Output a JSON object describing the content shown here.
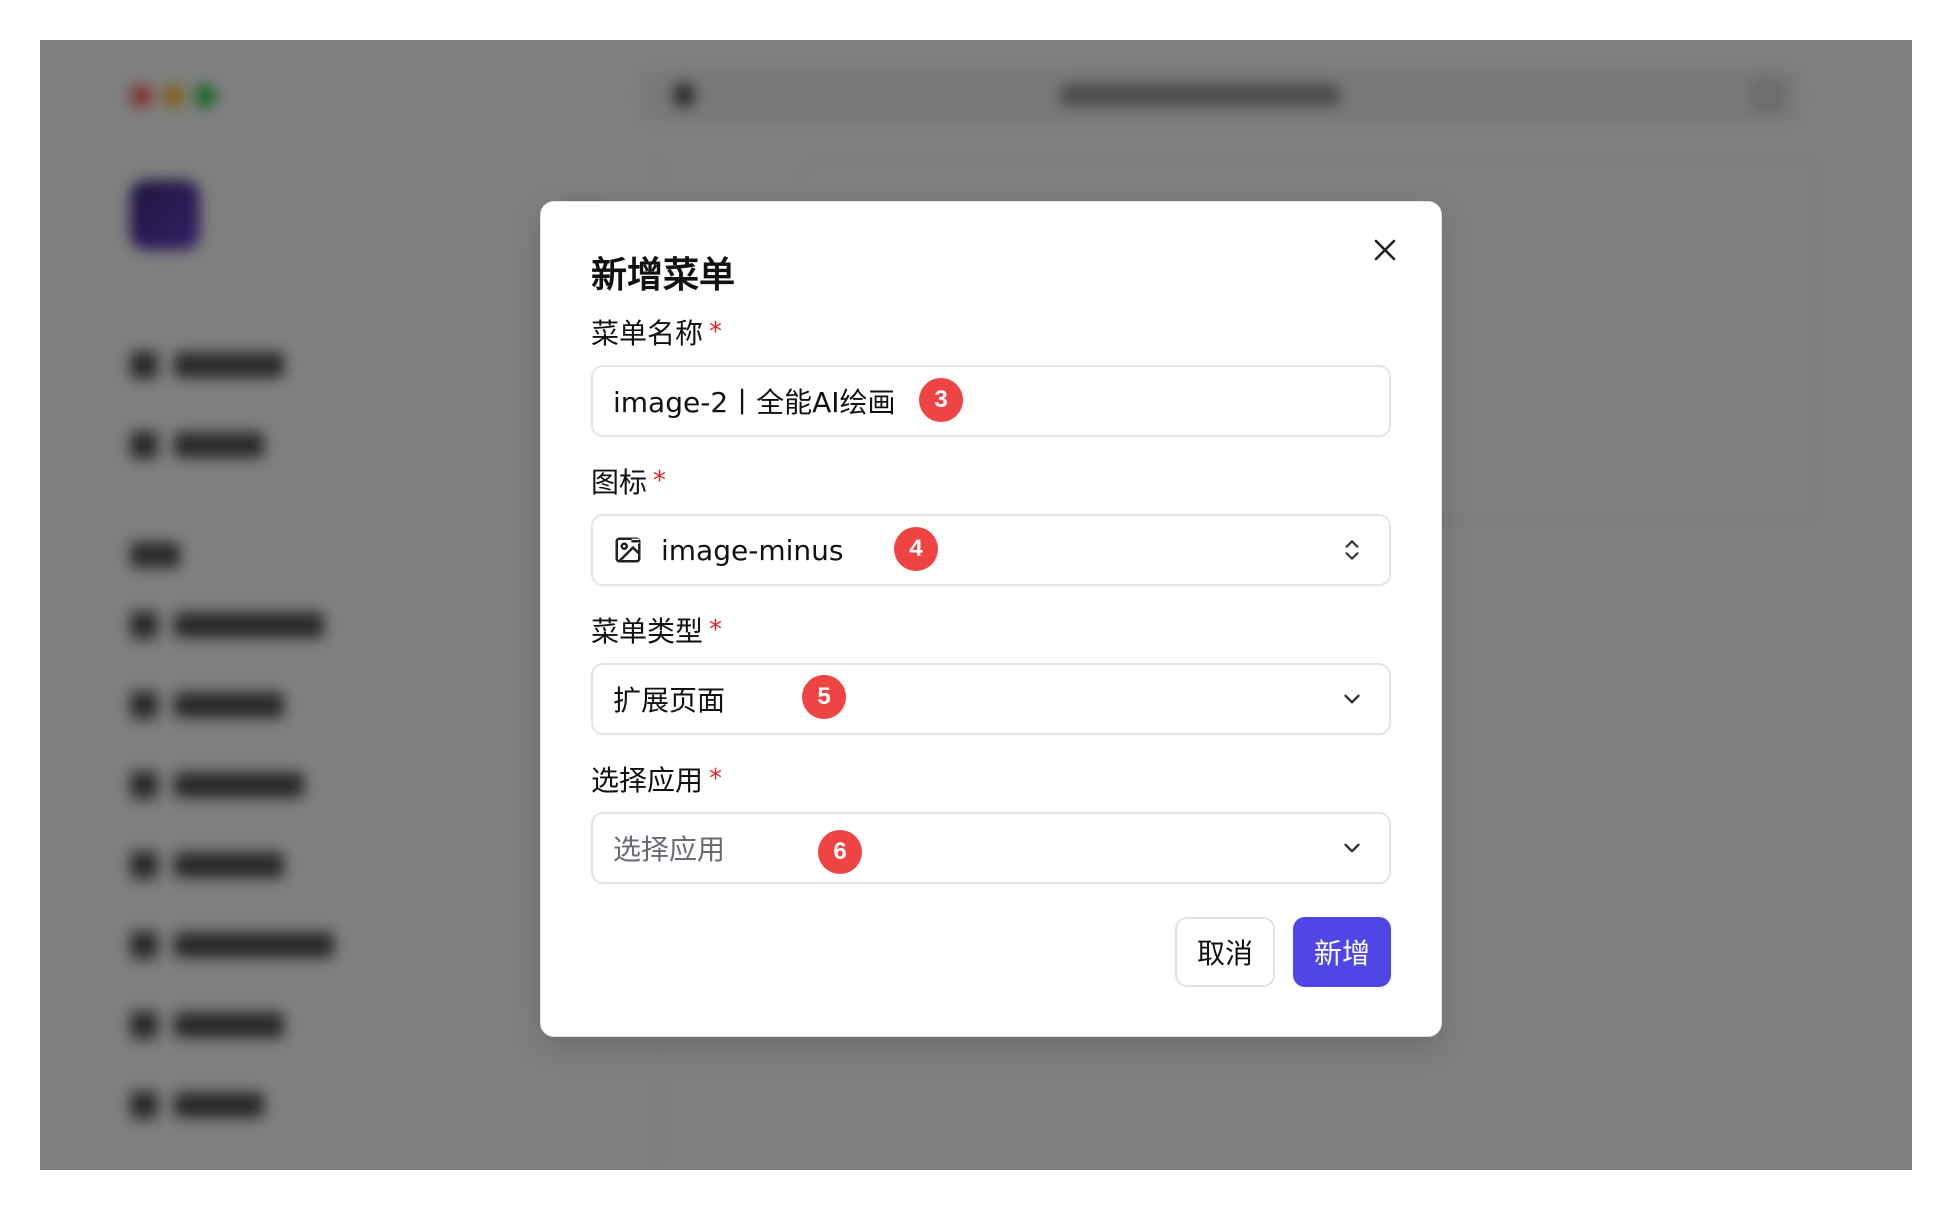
{
  "modal": {
    "title": "新增菜单",
    "fields": {
      "name": {
        "label": "菜单名称",
        "required_mark": "*",
        "value": "image-2丨全能AI绘画",
        "step": "3"
      },
      "icon": {
        "label": "图标",
        "required_mark": "*",
        "value": "image-minus",
        "icon_name": "image-minus-icon",
        "step": "4"
      },
      "type": {
        "label": "菜单类型",
        "required_mark": "*",
        "value": "扩展页面",
        "step": "5"
      },
      "app": {
        "label": "选择应用",
        "required_mark": "*",
        "placeholder": "选择应用",
        "step": "6"
      }
    },
    "buttons": {
      "cancel": "取消",
      "submit": "新增"
    }
  },
  "colors": {
    "primary": "#4f46e5",
    "required": "#e02424",
    "badge": "#ef4444",
    "overlay": "rgba(0,0,0,0.5)"
  }
}
